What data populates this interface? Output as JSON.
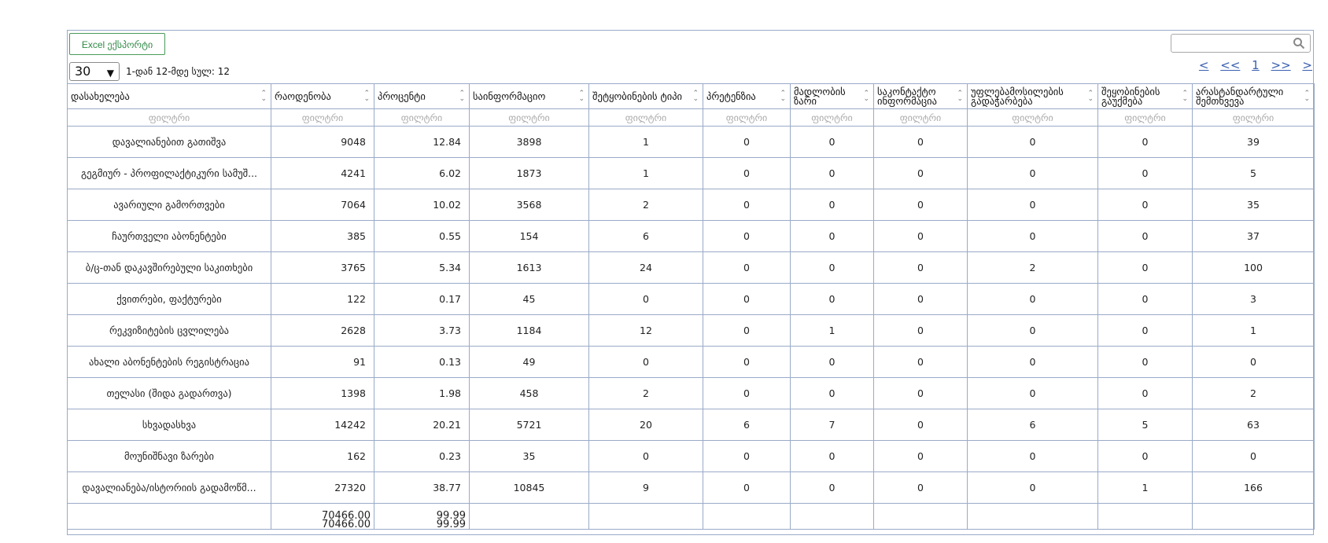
{
  "toolbar": {
    "export_label": "Excel ექსპორტი",
    "page_size": "30",
    "range_text": "1-დან 12-მდე სულ: 12",
    "pager": [
      "<",
      "<<",
      "1",
      ">>",
      ">"
    ]
  },
  "search": {
    "placeholder": ""
  },
  "table": {
    "headers": [
      "დასახელება",
      "რაოდენობა",
      "პროცენტი",
      "საინფორმაციო",
      "შეტყობინების ტიპი",
      "პრეტენზია",
      "მადლობის ზარი",
      "საკონტაქტო ინფორმაცია",
      "უფლებამოსილების გადაჭარბება",
      "შეყობინების გაუქმება",
      "არასტანდარტული შემთხვევა"
    ],
    "filter_label": "ფილტრი",
    "rows": [
      [
        "დავალიანებით გათიშვა",
        "9048",
        "12.84",
        "3898",
        "1",
        "0",
        "0",
        "0",
        "0",
        "0",
        "39"
      ],
      [
        "გეგმიურ - პროფილაქტიკური სამუშ...",
        "4241",
        "6.02",
        "1873",
        "1",
        "0",
        "0",
        "0",
        "0",
        "0",
        "5"
      ],
      [
        "ავარიული გამორთვები",
        "7064",
        "10.02",
        "3568",
        "2",
        "0",
        "0",
        "0",
        "0",
        "0",
        "35"
      ],
      [
        "ჩაურთველი აბონენტები",
        "385",
        "0.55",
        "154",
        "6",
        "0",
        "0",
        "0",
        "0",
        "0",
        "37"
      ],
      [
        "ბ/ც-თან დაკავშირებული საკითხები",
        "3765",
        "5.34",
        "1613",
        "24",
        "0",
        "0",
        "0",
        "2",
        "0",
        "100"
      ],
      [
        "ქვითრები, ფაქტურები",
        "122",
        "0.17",
        "45",
        "0",
        "0",
        "0",
        "0",
        "0",
        "0",
        "3"
      ],
      [
        "რეკვიზიტების ცვლილება",
        "2628",
        "3.73",
        "1184",
        "12",
        "0",
        "1",
        "0",
        "0",
        "0",
        "1"
      ],
      [
        "ახალი აბონენტების რეგისტრაცია",
        "91",
        "0.13",
        "49",
        "0",
        "0",
        "0",
        "0",
        "0",
        "0",
        "0"
      ],
      [
        "თელასი (შიდა გადართვა)",
        "1398",
        "1.98",
        "458",
        "2",
        "0",
        "0",
        "0",
        "0",
        "0",
        "2"
      ],
      [
        "სხვადასხვა",
        "14242",
        "20.21",
        "5721",
        "20",
        "6",
        "7",
        "0",
        "6",
        "5",
        "63"
      ],
      [
        "მოუნიშნავი ზარები",
        "162",
        "0.23",
        "35",
        "0",
        "0",
        "0",
        "0",
        "0",
        "0",
        "0"
      ],
      [
        "დავალიანება/ისტორიის გადამოწმ...",
        "27320",
        "38.77",
        "10845",
        "9",
        "0",
        "0",
        "0",
        "0",
        "1",
        "166"
      ]
    ],
    "footer": {
      "count_line1": "70466.00",
      "count_line2": "70466.00",
      "pct_line1": "99.99",
      "pct_line2": "99.99"
    }
  }
}
